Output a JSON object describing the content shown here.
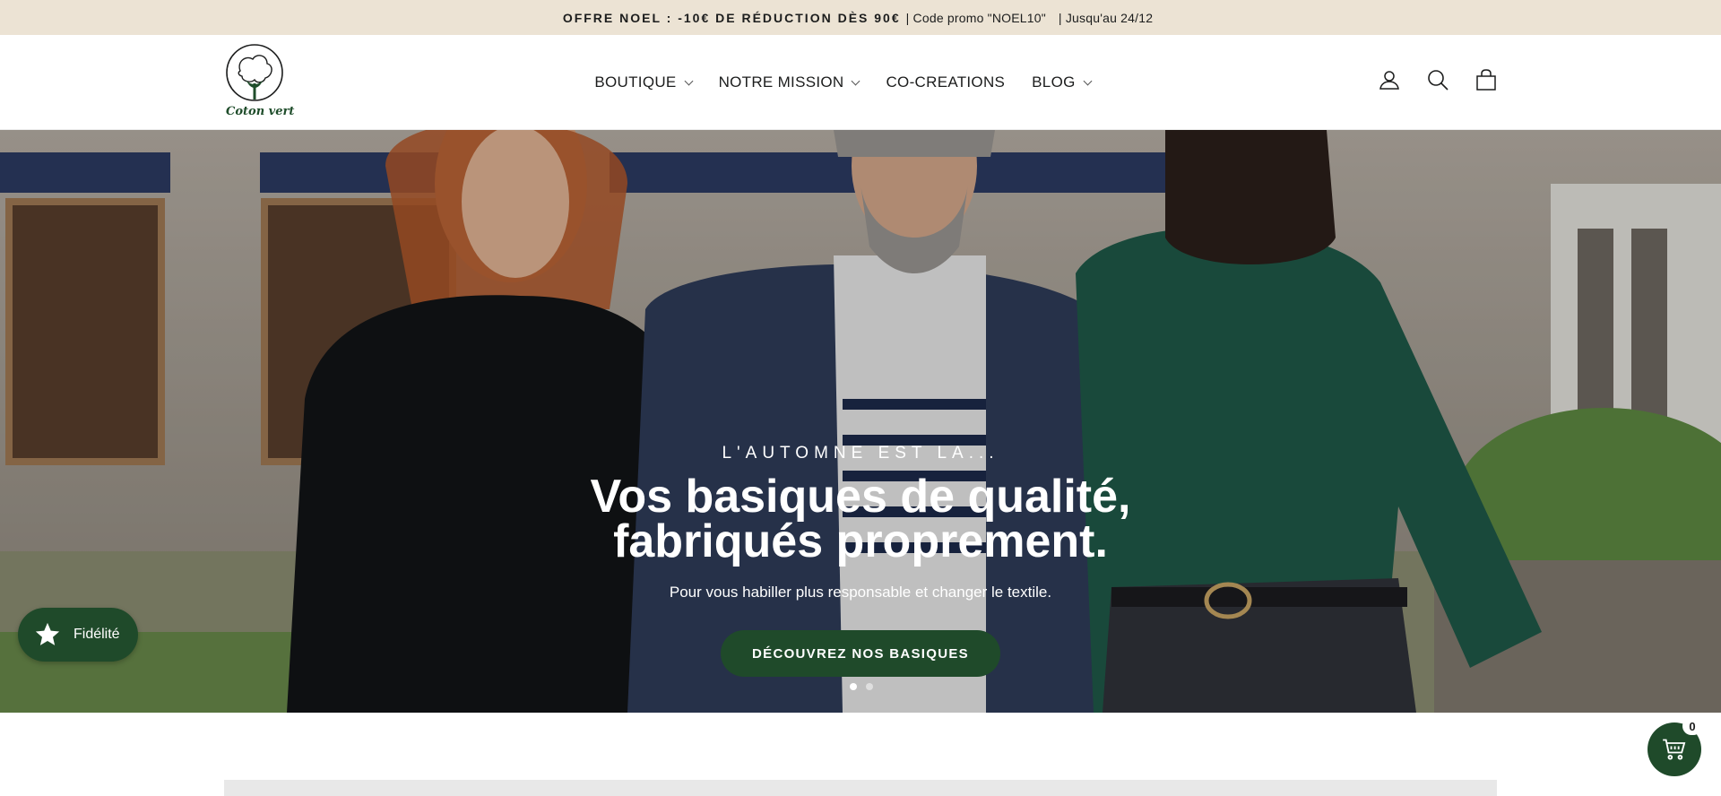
{
  "announcement": {
    "bold": "OFFRE NOEL : -10€ DE RÉDUCTION DÈS 90€",
    "promo": "| Code promo \"NOEL10\"",
    "until": "| Jusqu'au 24/12"
  },
  "header": {
    "logo_text": "Coton vert",
    "nav": [
      {
        "label": "BOUTIQUE",
        "dropdown": true
      },
      {
        "label": "NOTRE MISSION",
        "dropdown": true
      },
      {
        "label": "CO-CREATIONS",
        "dropdown": false
      },
      {
        "label": "BLOG",
        "dropdown": true
      }
    ],
    "icons": [
      "account-icon",
      "search-icon",
      "cart-icon"
    ]
  },
  "hero": {
    "kicker": "L'AUTOMNE EST LA...",
    "headline_line1": "Vos basiques de qualité,",
    "headline_line2": "fabriqués proprement.",
    "subline": "Pour vous habiller plus responsable et changer le textile.",
    "cta": "DÉCOUVREZ NOS BASIQUES",
    "slides": 2,
    "active_slide": 1
  },
  "loyalty": {
    "label": "Fidélité",
    "icon": "star-icon"
  },
  "cart_fab": {
    "count": "0",
    "icon": "basket-icon"
  },
  "colors": {
    "announcement_bg": "#ece3d4",
    "brand_green": "#1f4a2a"
  }
}
